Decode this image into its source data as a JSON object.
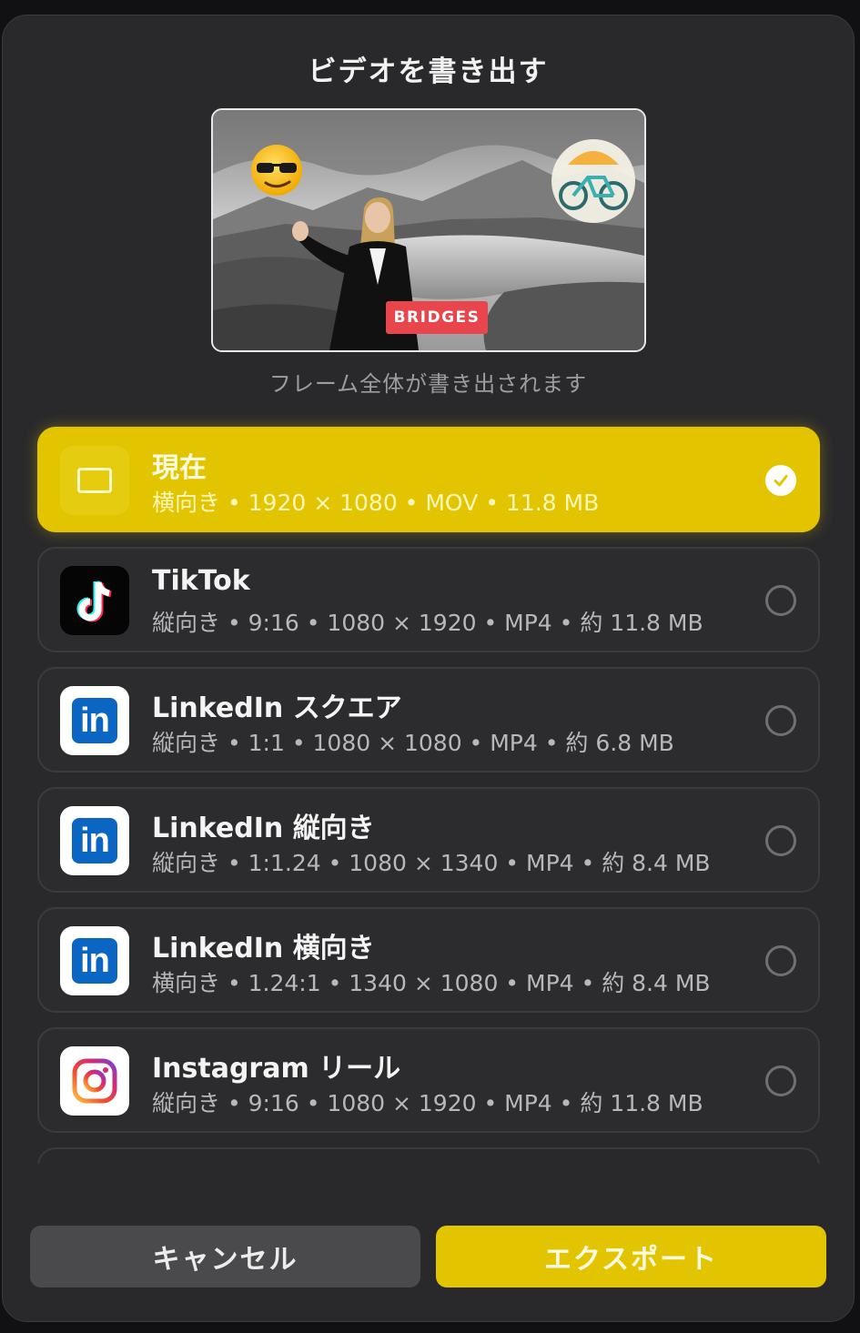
{
  "dialog": {
    "title": "ビデオを書き出す",
    "preview": {
      "badge_text": "BRIDGES"
    },
    "caption": "フレーム全体が書き出されます"
  },
  "options": [
    {
      "name": "現在",
      "detail": "横向き • 1920 × 1080 • MOV • 11.8 MB",
      "icon": "frame-icon",
      "selected": true
    },
    {
      "name": "TikTok",
      "detail": "縦向き • 9:16 • 1080 × 1920 • MP4 • 約 11.8 MB",
      "icon": "tiktok-icon",
      "selected": false
    },
    {
      "name": "LinkedIn スクエア",
      "detail": "縦向き • 1:1 • 1080 × 1080 • MP4 • 約 6.8 MB",
      "icon": "linkedin-icon",
      "selected": false
    },
    {
      "name": "LinkedIn 縦向き",
      "detail": "縦向き • 1:1.24 • 1080 × 1340 • MP4 • 約 8.4 MB",
      "icon": "linkedin-icon",
      "selected": false
    },
    {
      "name": "LinkedIn 横向き",
      "detail": "横向き • 1.24:1 • 1340 × 1080 • MP4 • 約 8.4 MB",
      "icon": "linkedin-icon",
      "selected": false
    },
    {
      "name": "Instagram リール",
      "detail": "縦向き • 9:16 • 1080 × 1920 • MP4 • 約 11.8 MB",
      "icon": "instagram-icon",
      "selected": false
    }
  ],
  "linkedin_glyph": "in",
  "buttons": {
    "cancel": "キャンセル",
    "export": "エクスポート"
  },
  "colors": {
    "accent": "#e2c500",
    "background": "#29292b",
    "linkedin": "#0a66c2"
  }
}
